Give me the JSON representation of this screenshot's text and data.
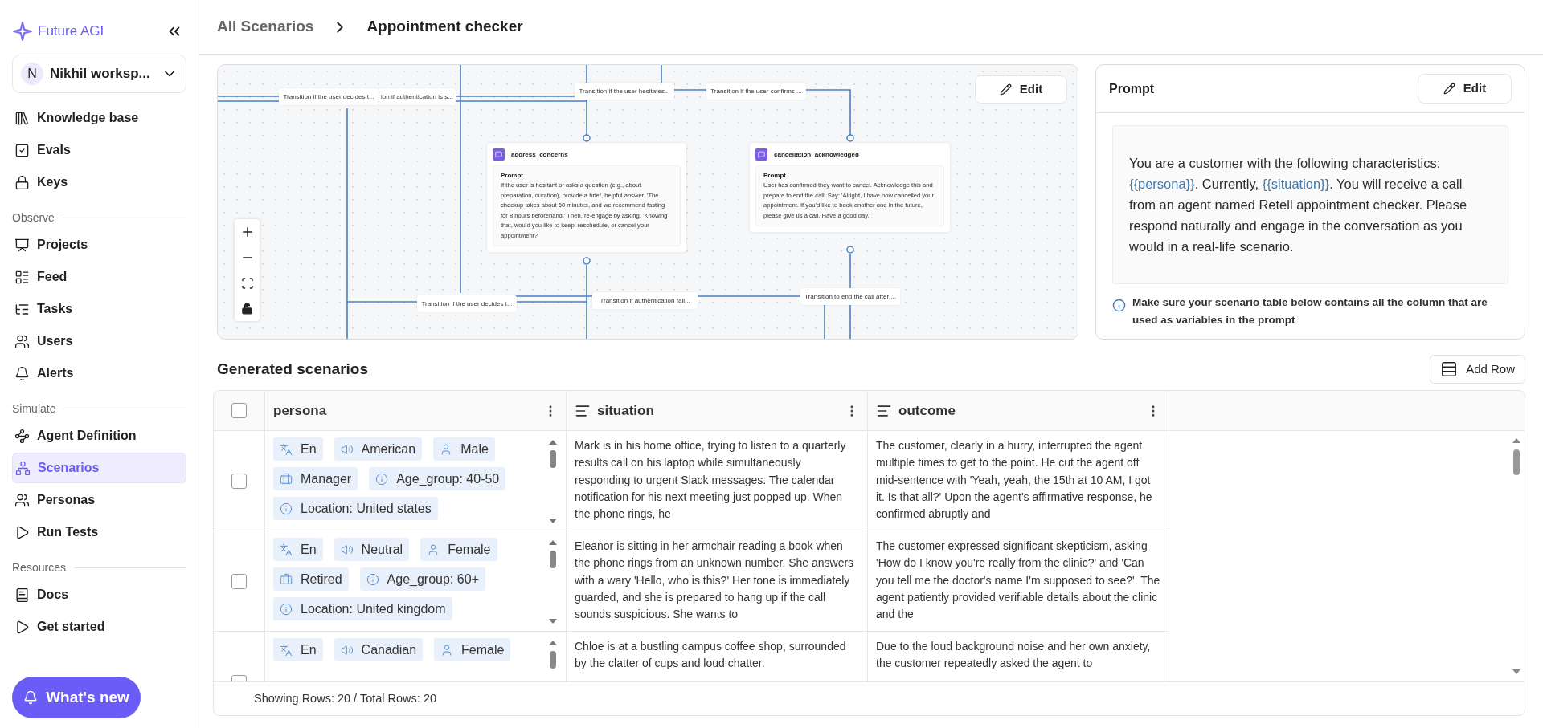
{
  "brand": {
    "name": "Future AGI"
  },
  "workspace": {
    "initial": "N",
    "name": "Nikhil worksp..."
  },
  "sidebar": {
    "sections": [
      {
        "items": [
          {
            "label": "Knowledge base",
            "selected": false
          },
          {
            "label": "Evals",
            "selected": false
          },
          {
            "label": "Keys",
            "selected": false
          }
        ]
      },
      {
        "title": "Observe",
        "items": [
          {
            "label": "Projects",
            "selected": false
          },
          {
            "label": "Feed",
            "selected": false
          },
          {
            "label": "Tasks",
            "selected": false
          },
          {
            "label": "Users",
            "selected": false
          },
          {
            "label": "Alerts",
            "selected": false
          }
        ]
      },
      {
        "title": "Simulate",
        "items": [
          {
            "label": "Agent Definition",
            "selected": false
          },
          {
            "label": "Scenarios",
            "selected": true
          },
          {
            "label": "Personas",
            "selected": false
          },
          {
            "label": "Run Tests",
            "selected": false
          }
        ]
      },
      {
        "title": "Resources",
        "items": [
          {
            "label": "Docs",
            "selected": false
          },
          {
            "label": "Get started",
            "selected": false
          }
        ]
      }
    ],
    "whats_new": "What's new"
  },
  "breadcrumb": [
    "All Scenarios",
    "Appointment checker"
  ],
  "canvas": {
    "edit_button": "Edit",
    "edge_labels": [
      "Transition if the user decides t...",
      "ion if authentication is s...",
      "Transition if the user hesitates...",
      "Transition if the user confirms ...",
      "Transition if the user decides t...",
      "Transition if authentication fail...",
      "Transition to end the call after ..."
    ],
    "nodes": [
      {
        "name": "address_concerns",
        "prompt_title": "Prompt",
        "prompt": "If the user is hesitant or asks a question (e.g., about preparation, duration), provide a brief, helpful answer. 'The checkup takes about 60 minutes, and we recommend fasting for 8 hours beforehand.' Then, re-engage by asking, 'Knowing that, would you like to keep, reschedule, or cancel your appointment?'"
      },
      {
        "name": "cancellation_acknowledged",
        "prompt_title": "Prompt",
        "prompt": "User has confirmed they want to cancel. Acknowledge this and prepare to end the call. Say: 'Alright, I have now cancelled your appointment. If you'd like to book another one in the future, please give us a call. Have a good day.'"
      }
    ]
  },
  "prompt_panel": {
    "title": "Prompt",
    "edit_button": "Edit",
    "segments": [
      {
        "kind": "text",
        "text": "You are a customer with the following characteristics: "
      },
      {
        "kind": "variable",
        "text": "{{persona}}"
      },
      {
        "kind": "text",
        "text": ". Currently, "
      },
      {
        "kind": "variable",
        "text": "{{situation}}"
      },
      {
        "kind": "text",
        "text": ". You will receive a call from an agent named Retell appointment checker. Please respond naturally and engage in the conversation as you would in a real-life scenario."
      }
    ],
    "note": "Make sure your scenario table below contains all the column that are used as variables in the prompt"
  },
  "scenarios": {
    "title": "Generated scenarios",
    "add_row": "Add Row",
    "select_all_checked": false,
    "columns": [
      {
        "name": "persona",
        "kind": "tags"
      },
      {
        "name": "situation",
        "kind": "text"
      },
      {
        "name": "outcome",
        "kind": "text"
      }
    ],
    "rows": [
      {
        "checked": false,
        "persona": [
          {
            "kind": "language",
            "text": "En"
          },
          {
            "kind": "accent",
            "text": "American"
          },
          {
            "kind": "gender",
            "text": "Male"
          },
          {
            "kind": "occupation",
            "text": "Manager"
          },
          {
            "kind": "info",
            "text": "Age_group: 40-50"
          },
          {
            "kind": "info",
            "text": "Location: United states"
          }
        ],
        "situation": "Mark is in his home office, trying to listen to a quarterly results call on his laptop while simultaneously responding to urgent Slack messages. The calendar notification for his next meeting just popped up. When the phone rings, he",
        "outcome": "The customer, clearly in a hurry, interrupted the agent multiple times to get to the point. He cut the agent off mid-sentence with 'Yeah, yeah, the 15th at 10 AM, I got it. Is that all?' Upon the agent's affirmative response, he confirmed abruptly and"
      },
      {
        "checked": false,
        "persona": [
          {
            "kind": "language",
            "text": "En"
          },
          {
            "kind": "accent",
            "text": "Neutral"
          },
          {
            "kind": "gender",
            "text": "Female"
          },
          {
            "kind": "occupation",
            "text": "Retired"
          },
          {
            "kind": "info",
            "text": "Age_group: 60+"
          },
          {
            "kind": "info",
            "text": "Location: United kingdom"
          }
        ],
        "situation": "Eleanor is sitting in her armchair reading a book when the phone rings from an unknown number. She answers with a wary 'Hello, who is this?' Her tone is immediately guarded, and she is prepared to hang up if the call sounds suspicious. She wants to",
        "outcome": "The customer expressed significant skepticism, asking 'How do I know you're really from the clinic?' and 'Can you tell me the doctor's name I'm supposed to see?'. The agent patiently provided verifiable details about the clinic and the"
      },
      {
        "checked": false,
        "persona": [
          {
            "kind": "language",
            "text": "En"
          },
          {
            "kind": "accent",
            "text": "Canadian"
          },
          {
            "kind": "gender",
            "text": "Female"
          }
        ],
        "situation": "Chloe is at a bustling campus coffee shop, surrounded by the clatter of cups and loud chatter.",
        "outcome": "Due to the loud background noise and her own anxiety, the customer repeatedly asked the agent to"
      }
    ],
    "footer": "Showing Rows: 20 / Total Rows: 20"
  }
}
